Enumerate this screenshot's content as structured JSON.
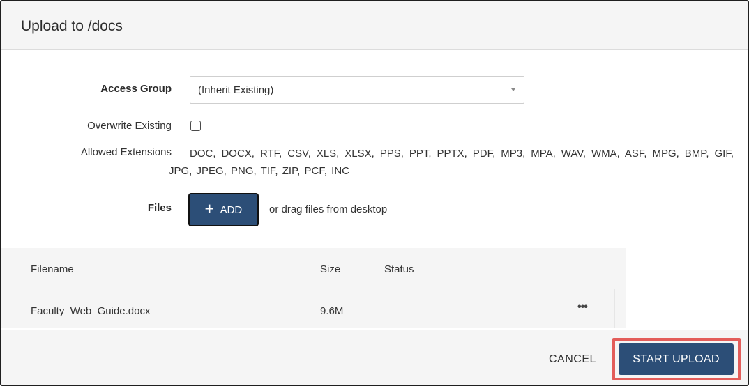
{
  "dialog": {
    "title": "Upload to /docs"
  },
  "form": {
    "access_group": {
      "label": "Access Group",
      "value": "(Inherit Existing)"
    },
    "overwrite": {
      "label": "Overwrite Existing",
      "checked": false
    },
    "allowed_extensions": {
      "label": "Allowed Extensions",
      "value": "DOC, DOCX, RTF, CSV, XLS, XLSX, PPS, PPT, PPTX, PDF, MP3, MPA, WAV, WMA, ASF, MPG, BMP, GIF, JPG, JPEG, PNG, TIF, ZIP, PCF, INC"
    },
    "files": {
      "label": "Files",
      "add_button": "ADD",
      "drag_hint": "or drag files from desktop",
      "add_icon": "plus-icon"
    }
  },
  "table": {
    "headers": [
      "Filename",
      "Size",
      "Status"
    ],
    "rows": [
      {
        "filename": "Faculty_Web_Guide.docx",
        "size": "9.6M",
        "status": "",
        "menu_icon": "ellipsis-icon"
      }
    ]
  },
  "footer": {
    "cancel_label": "CANCEL",
    "start_label": "START UPLOAD",
    "highlight_color": "#e35d5a",
    "primary_color": "#2c4e77"
  }
}
